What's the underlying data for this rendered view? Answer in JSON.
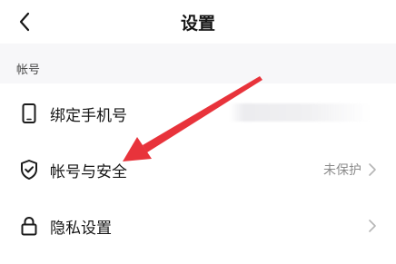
{
  "header": {
    "back_icon": "chevron-left-icon",
    "title": "设置"
  },
  "section": {
    "label": "帐号"
  },
  "rows": [
    {
      "label": "绑定手机号",
      "icon": "phone-icon",
      "value": ""
    },
    {
      "label": "帐号与安全",
      "icon": "shield-check-icon",
      "value": "未保护"
    },
    {
      "label": "隐私设置",
      "icon": "lock-icon",
      "value": ""
    }
  ],
  "colors": {
    "annotation_arrow": "#e8333b",
    "section_background": "#f7f7f9",
    "secondary_text": "#8c8c8c"
  }
}
